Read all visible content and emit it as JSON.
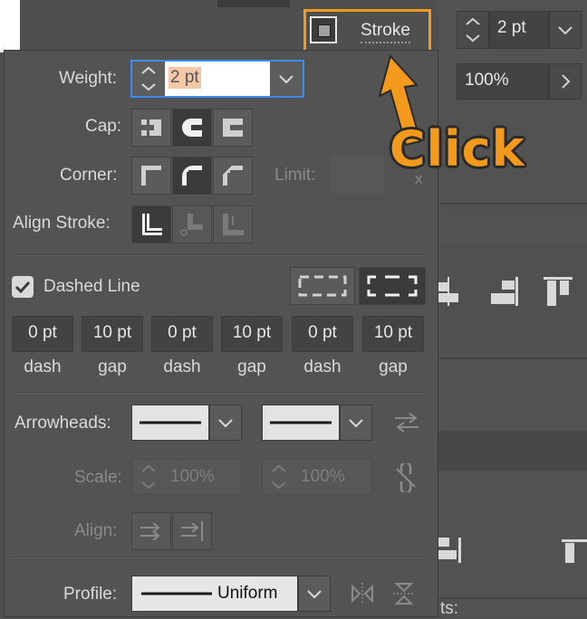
{
  "header": {
    "stroke_label": "Stroke",
    "weight_value": "2 pt",
    "opacity_value": "100%"
  },
  "callout": {
    "text": "Click",
    "color": "#f39a1d"
  },
  "panel": {
    "weight": {
      "label": "Weight:",
      "value": "2 pt"
    },
    "cap": {
      "label": "Cap:"
    },
    "corner": {
      "label": "Corner:",
      "limit_label": "Limit:",
      "limit_suffix": "x"
    },
    "align_stroke": {
      "label": "Align Stroke:"
    },
    "dashed": {
      "label": "Dashed Line",
      "checked": true,
      "fields": [
        {
          "value": "0 pt",
          "sub": "dash"
        },
        {
          "value": "10 pt",
          "sub": "gap"
        },
        {
          "value": "0 pt",
          "sub": "dash"
        },
        {
          "value": "10 pt",
          "sub": "gap"
        },
        {
          "value": "0 pt",
          "sub": "dash"
        },
        {
          "value": "10 pt",
          "sub": "gap"
        }
      ]
    },
    "arrowheads": {
      "label": "Arrowheads:"
    },
    "scale": {
      "label": "Scale:",
      "start": "100%",
      "end": "100%"
    },
    "align": {
      "label": "Align:"
    },
    "profile": {
      "label": "Profile:",
      "value": "Uniform"
    }
  },
  "background": {
    "partial_text": "ts:"
  },
  "colors": {
    "accent": "#f29a1f",
    "panel": "#535353",
    "highlight": "#f5c9a8"
  }
}
